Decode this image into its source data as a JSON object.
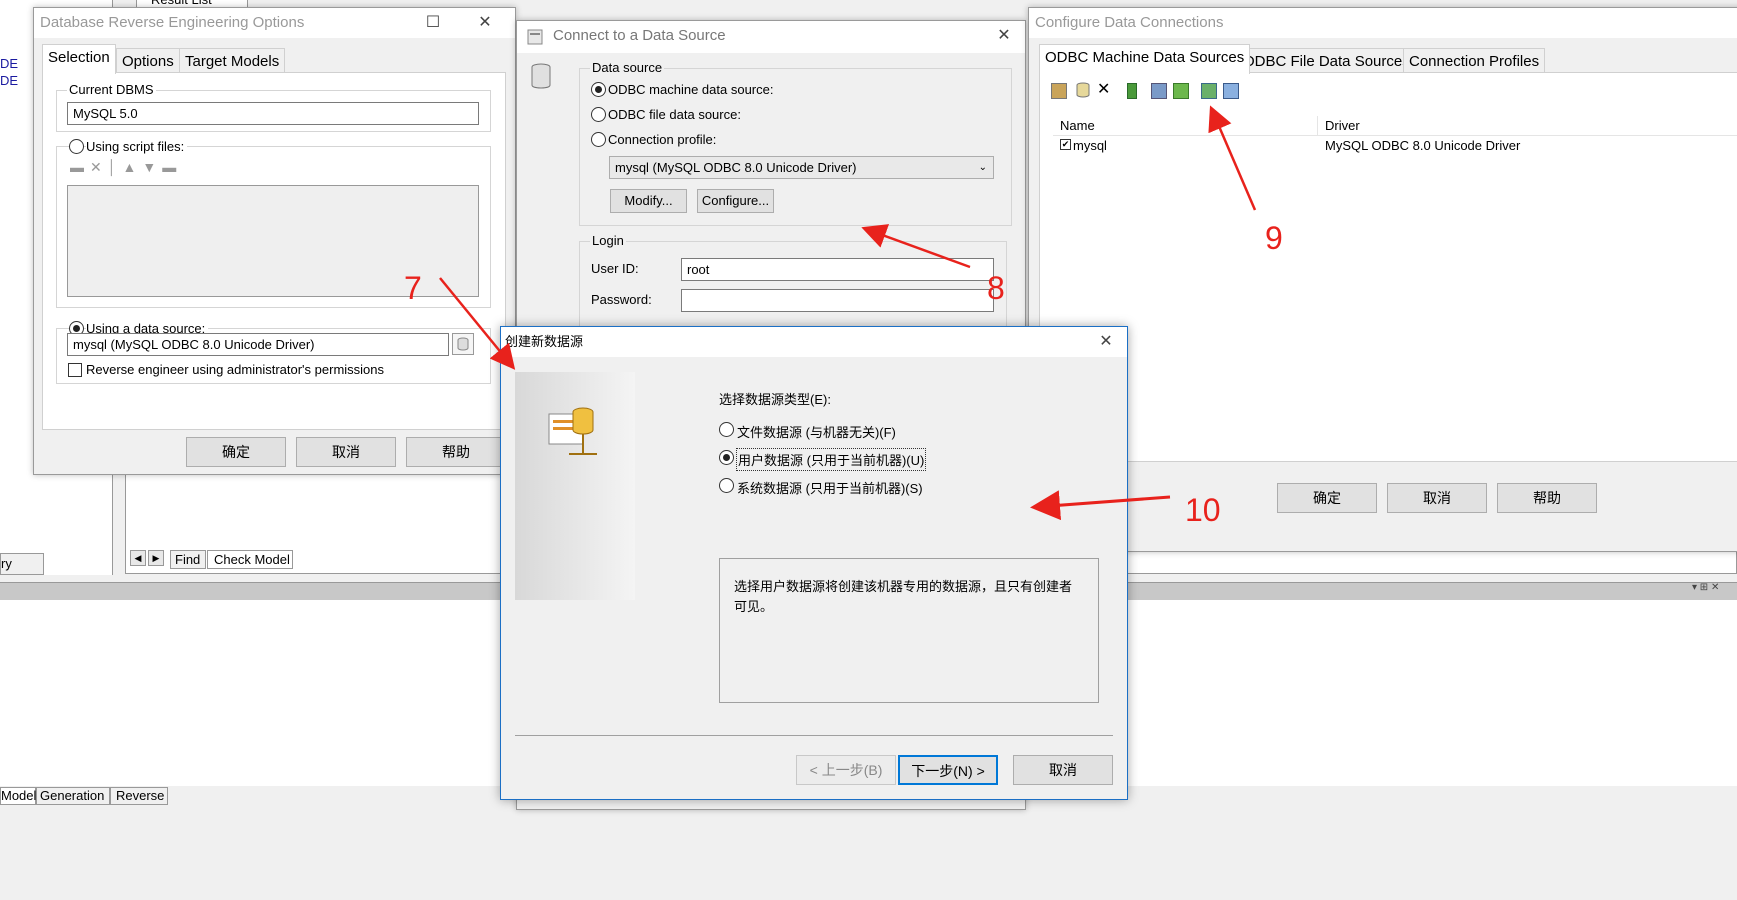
{
  "background": {
    "result_tab": "Result List",
    "left_links": [
      "DE",
      "DE"
    ],
    "left_cut_label": "ry",
    "model_tabs": [
      "Find",
      "Check Model"
    ],
    "bottom_tabs": [
      "Model",
      "Generation",
      "Reverse"
    ]
  },
  "reverse_dialog": {
    "title": "Database Reverse Engineering Options",
    "tabs": [
      "Selection",
      "Options",
      "Target Models"
    ],
    "current_dbms_label": "Current DBMS",
    "current_dbms_value": "MySQL 5.0",
    "script_files_label": "Using script files:",
    "data_source_label": "Using a data source:",
    "data_source_value": "mysql (MySQL ODBC 8.0 Unicode Driver)",
    "admin_label": "Reverse engineer using administrator's permissions",
    "ok": "确定",
    "cancel": "取消",
    "help": "帮助"
  },
  "connect_dialog": {
    "title": "Connect to a Data Source",
    "data_source_group": "Data source",
    "opt_machine": "ODBC machine data source:",
    "opt_file": "ODBC file data source:",
    "opt_profile": "Connection profile:",
    "select_value": "mysql (MySQL ODBC 8.0 Unicode Driver)",
    "modify": "Modify...",
    "configure": "Configure...",
    "login_group": "Login",
    "user_id_label": "User ID:",
    "user_id_value": "root",
    "password_label": "Password:"
  },
  "configure_dialog": {
    "title": "Configure Data Connections",
    "tabs": [
      "ODBC Machine Data Sources",
      "ODBC File Data Sources",
      "Connection Profiles"
    ],
    "col_name": "Name",
    "col_driver": "Driver",
    "row_name": "mysql",
    "row_driver": "MySQL ODBC 8.0 Unicode Driver",
    "ok": "确定",
    "cancel": "取消",
    "help": "帮助"
  },
  "new_ds_dialog": {
    "title": "创建新数据源",
    "prompt": "选择数据源类型(E):",
    "opt_file": "文件数据源 (与机器无关)(F)",
    "opt_user": "用户数据源 (只用于当前机器)(U)",
    "opt_system": "系统数据源 (只用于当前机器)(S)",
    "description": "选择用户数据源将创建该机器专用的数据源，且只有创建者可见。",
    "back": "< 上一步(B)",
    "next": "下一步(N) >",
    "cancel": "取消"
  },
  "annotations": [
    "7",
    "8",
    "9",
    "10"
  ],
  "annotation_color": "#e8221c"
}
